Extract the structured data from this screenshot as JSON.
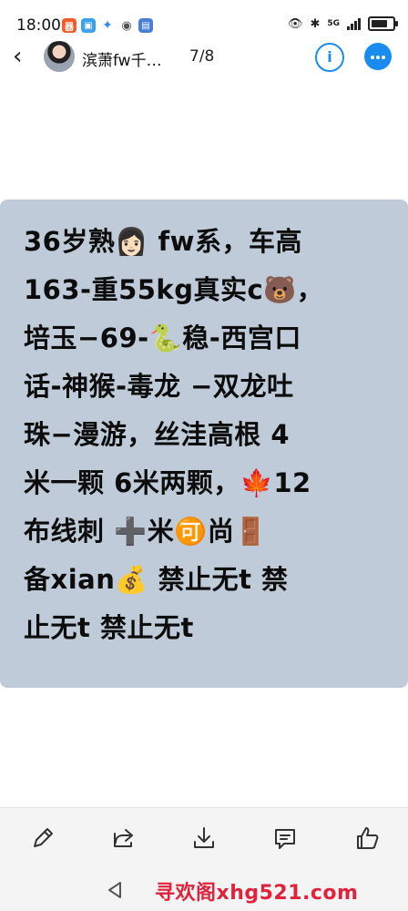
{
  "status_bar": {
    "time": "18:00",
    "network": "5G",
    "battery_level": 0.75,
    "notification_colors": [
      "#f25c2a",
      "#3aa0f0",
      "#2f8df0",
      "#555555",
      "#4a7fd9"
    ]
  },
  "header": {
    "title": "滨萧fw千…",
    "page_indicator": "7/8",
    "info_label": "i"
  },
  "image": {
    "background": "#bfcbd9",
    "text": "36岁熟👩🏻  fw系，车高\n163-重55kg真实c🐻，\n培玉−69-🐍稳-西宫口\n话-神猴-毒龙 −双龙吐\n珠−漫游，丝洼高根    4\n米一颗 6米两颗，🍁12\n布线刺   ➕米🉑尚🚪\n备xian💰    禁止无t    禁\n止无t  禁止无t"
  },
  "toolbar": {
    "icons": [
      "edit-icon",
      "share-icon",
      "download-icon",
      "comment-icon",
      "like-icon"
    ]
  },
  "watermark": {
    "text": "寻欢阁xhg521.com",
    "color": "#e0233b"
  }
}
